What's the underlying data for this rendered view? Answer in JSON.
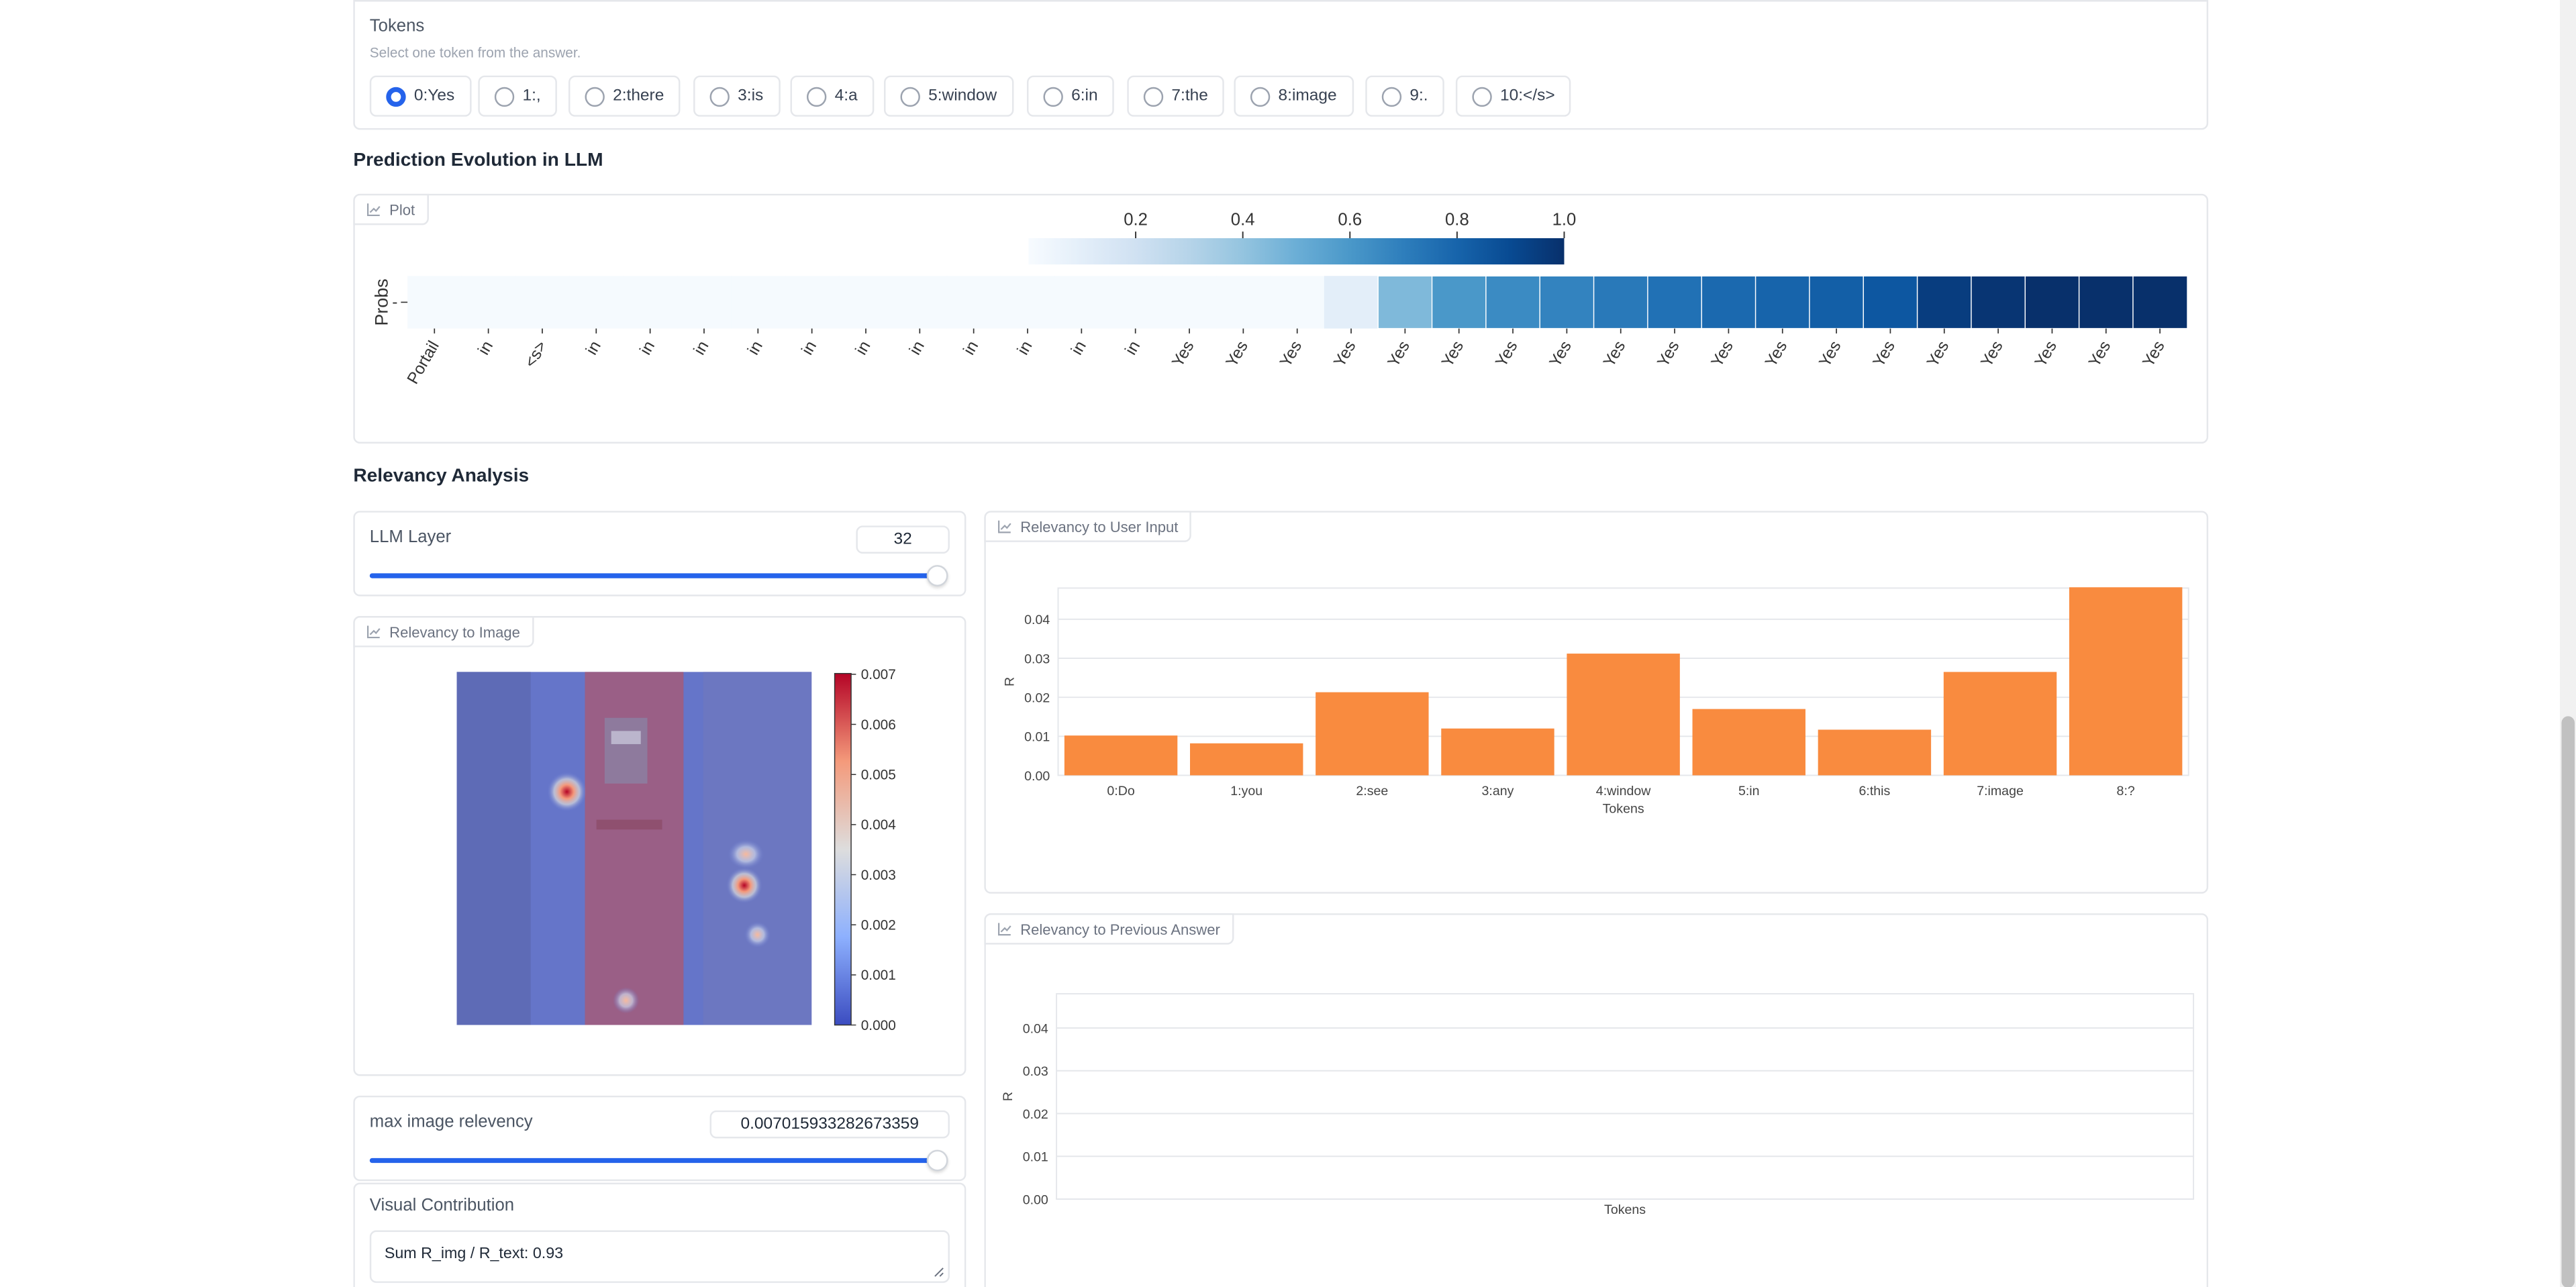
{
  "tokens_section": {
    "title": "Tokens",
    "subtitle": "Select one token from the answer.",
    "options": [
      "0:Yes",
      "1:,",
      "2:there",
      "3:is",
      "4:a",
      "5:window",
      "6:in",
      "7:the",
      "8:image",
      "9:.",
      "10:</s>"
    ],
    "selected_index": 0
  },
  "prediction_section": {
    "title": "Prediction Evolution in LLM",
    "plot_label": "Plot",
    "y_tick": "Probs",
    "colorbar_ticks": [
      "0.2",
      "0.4",
      "0.6",
      "0.8",
      "1.0"
    ]
  },
  "relevancy_section": {
    "title": "Relevancy Analysis",
    "llm_layer": {
      "label": "LLM Layer",
      "value": "32",
      "fraction": 1.0
    },
    "image_panel": {
      "label": "Relevancy to Image",
      "colorbar_ticks": [
        "0.007",
        "0.006",
        "0.005",
        "0.004",
        "0.003",
        "0.002",
        "0.001",
        "0.000"
      ]
    },
    "user_input_panel": {
      "label": "Relevancy to User Input"
    },
    "previous_answer_panel": {
      "label": "Relevancy to Previous Answer"
    },
    "max_relevancy": {
      "label": "max image relevency",
      "value": "0.007015933282673359",
      "fraction": 1.0
    },
    "visual_contribution": {
      "label": "Visual Contribution",
      "value": "Sum R_img / R_text: 0.93"
    }
  },
  "colors": {
    "accent": "#2563eb",
    "bar": "#f98b3f",
    "heat_dark": "#08306b",
    "heat_light": "#f7fbff"
  },
  "chart_data": [
    {
      "type": "heatmap",
      "title": "",
      "ylabel": "Probs",
      "y": [
        "-"
      ],
      "x": [
        "Portail",
        "in",
        "<s>",
        "in",
        "in",
        "in",
        "in",
        "in",
        "in",
        "in",
        "in",
        "in",
        "in",
        "in",
        "Yes",
        "Yes",
        "Yes",
        "Yes",
        "Yes",
        "Yes",
        "Yes",
        "Yes",
        "Yes",
        "Yes",
        "Yes",
        "Yes",
        "Yes",
        "Yes",
        "Yes",
        "Yes",
        "Yes",
        "Yes",
        "Yes"
      ],
      "values": [
        0.01,
        0.01,
        0.01,
        0.01,
        0.01,
        0.01,
        0.01,
        0.01,
        0.01,
        0.01,
        0.01,
        0.01,
        0.01,
        0.01,
        0.01,
        0.01,
        0.01,
        0.1,
        0.45,
        0.6,
        0.65,
        0.68,
        0.72,
        0.75,
        0.78,
        0.8,
        0.82,
        0.85,
        0.95,
        0.98,
        1.0,
        1.0,
        1.0
      ],
      "colorbar": {
        "min": 0.0,
        "max": 1.0,
        "ticks": [
          0.2,
          0.4,
          0.6,
          0.8,
          1.0
        ]
      }
    },
    {
      "type": "bar",
      "title": "",
      "categories": [
        "0:Do",
        "1:you",
        "2:see",
        "3:any",
        "4:window",
        "5:in",
        "6:this",
        "7:image",
        "8:?"
      ],
      "values": [
        0.0102,
        0.0082,
        0.0213,
        0.012,
        0.0312,
        0.017,
        0.0117,
        0.0265,
        0.0482
      ],
      "xlabel": "Tokens",
      "ylabel": "R",
      "ylim": [
        0,
        0.048
      ],
      "yticks": [
        "0.00",
        "0.01",
        "0.02",
        "0.03",
        "0.04"
      ],
      "grid": true
    },
    {
      "type": "bar",
      "title": "",
      "categories": [],
      "values": [],
      "xlabel": "Tokens",
      "ylabel": "R",
      "ylim": [
        0,
        0.048
      ],
      "yticks": [
        "0.00",
        "0.01",
        "0.02",
        "0.03",
        "0.04"
      ],
      "grid": true
    }
  ]
}
